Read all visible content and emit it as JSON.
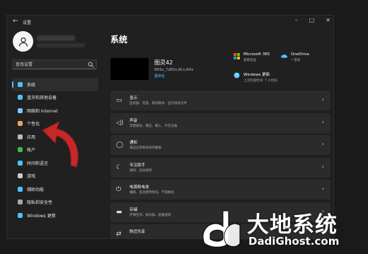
{
  "window": {
    "title": "设置",
    "back_icon": "back-arrow-icon"
  },
  "sidebar": {
    "search_placeholder": "查找设置",
    "items": [
      {
        "label": "系统",
        "icon": "system-icon",
        "color": "#4cc2ff",
        "active": true
      },
      {
        "label": "蓝牙和其他设备",
        "icon": "bluetooth-icon",
        "color": "#4cc2ff"
      },
      {
        "label": "网络和 Internet",
        "icon": "network-icon",
        "color": "#7fc8ff"
      },
      {
        "label": "个性化",
        "icon": "personalization-icon",
        "color": "#f0a060"
      },
      {
        "label": "应用",
        "icon": "apps-icon",
        "color": "#bbbbbb"
      },
      {
        "label": "帐户",
        "icon": "account-icon",
        "color": "#3fb950"
      },
      {
        "label": "时间和语言",
        "icon": "time-language-icon",
        "color": "#4cc2ff"
      },
      {
        "label": "游戏",
        "icon": "gaming-icon",
        "color": "#cccccc"
      },
      {
        "label": "辅助功能",
        "icon": "accessibility-icon",
        "color": "#4cc2ff"
      },
      {
        "label": "隐私和安全性",
        "icon": "privacy-icon",
        "color": "#aaaaaa"
      },
      {
        "label": "Windows 更新",
        "icon": "windows-update-icon",
        "color": "#4cc2ff"
      }
    ]
  },
  "main": {
    "title": "系统",
    "device": {
      "name": "图灵42",
      "model": "NHSx_7xEDx,RCx,RDx",
      "rename": "重命名"
    },
    "services": [
      {
        "title": "Microsoft 365",
        "subtitle": "查看权益",
        "icon": "microsoft365-icon"
      },
      {
        "title": "OneDrive",
        "subtitle": "• 登录",
        "icon": "onedrive-icon"
      },
      {
        "title": "Windows 更新",
        "subtitle": "上次检查时间: 7 小时前",
        "icon": "windows-update-icon"
      }
    ],
    "cards": [
      {
        "title": "显示",
        "subtitle": "监视器、亮度、夜间模式、显示描述文件",
        "icon": "display-icon"
      },
      {
        "title": "声音",
        "subtitle": "音量级别、输出、输入、声音设备",
        "icon": "sound-icon"
      },
      {
        "title": "通知",
        "subtitle": "来自应用和系统的警报",
        "icon": "notifications-icon"
      },
      {
        "title": "专注助手",
        "subtitle": "通知、自动规则",
        "icon": "focus-assist-icon"
      },
      {
        "title": "电源和电池",
        "subtitle": "睡眠、电池使用情况、节电模式",
        "icon": "power-icon"
      },
      {
        "title": "存储",
        "subtitle": "存储空间、驱动器、配置规则",
        "icon": "storage-icon"
      },
      {
        "title": "附近共享",
        "subtitle": "",
        "icon": "nearby-sharing-icon"
      }
    ]
  },
  "watermark": {
    "cn": "大地系统",
    "en": "DadiGhost.com"
  },
  "colors": {
    "accent": "#4cc2ff",
    "arrow": "#c62828"
  }
}
